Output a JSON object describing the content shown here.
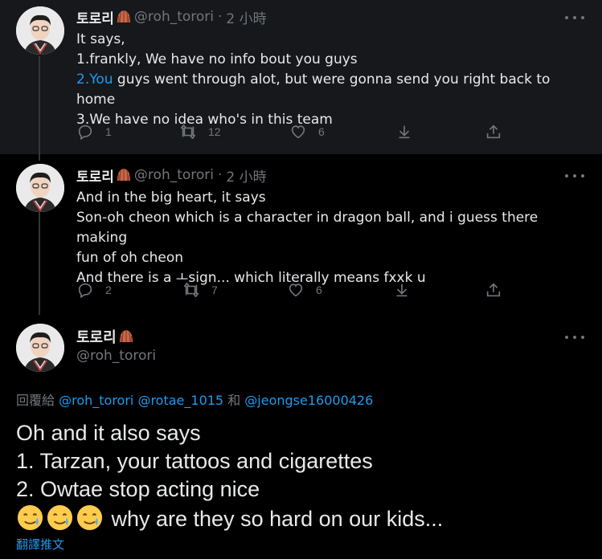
{
  "tweets": [
    {
      "name": "토로리",
      "handle": "@roh_torori",
      "dot": "·",
      "time": "2 小時",
      "line1": "It says,",
      "line2": "1.frankly, We have no info bout you guys",
      "line3_link": "2.You",
      "line3_rest": " guys went through alot, but were gonna send you right back to home",
      "line4": "3.We have no idea who's in this team",
      "replies": "1",
      "retweets": "12",
      "likes": "6"
    },
    {
      "name": "토로리",
      "handle": "@roh_torori",
      "dot": "·",
      "time": "2 小時",
      "line1": "And in the big heart, it says",
      "line2": "Son-oh cheon which is a character in dragon ball, and i guess there making",
      "line3": "fun of oh cheon",
      "line4": "And there is a ㅗsign... which literally means fxxk u",
      "replies": "2",
      "retweets": "7",
      "likes": "6"
    }
  ],
  "main": {
    "name": "토로리",
    "handle": "@roh_torori",
    "reply_prefix": "回覆給 ",
    "mention1": "@roh_torori",
    "mention2": "@rotae_1015",
    "reply_and": " 和 ",
    "mention3": "@jeongse16000426",
    "line1": "Oh and it also says",
    "line2": "1. Tarzan, your tattoos and cigarettes",
    "line3": "2. Owtae stop acting nice",
    "line4": " why are they so hard on our kids...",
    "translate": "翻譯推文"
  },
  "colors": {
    "background": "#000000",
    "highlight_bg": "#16181c",
    "link": "#1d9bf0",
    "muted": "#71767b",
    "text": "#e7e9ea"
  },
  "icons": [
    "reply-icon",
    "retweet-icon",
    "like-icon",
    "download-icon",
    "share-icon",
    "more-icon",
    "shell-emoji",
    "smiling-face-with-tear-emoji"
  ]
}
